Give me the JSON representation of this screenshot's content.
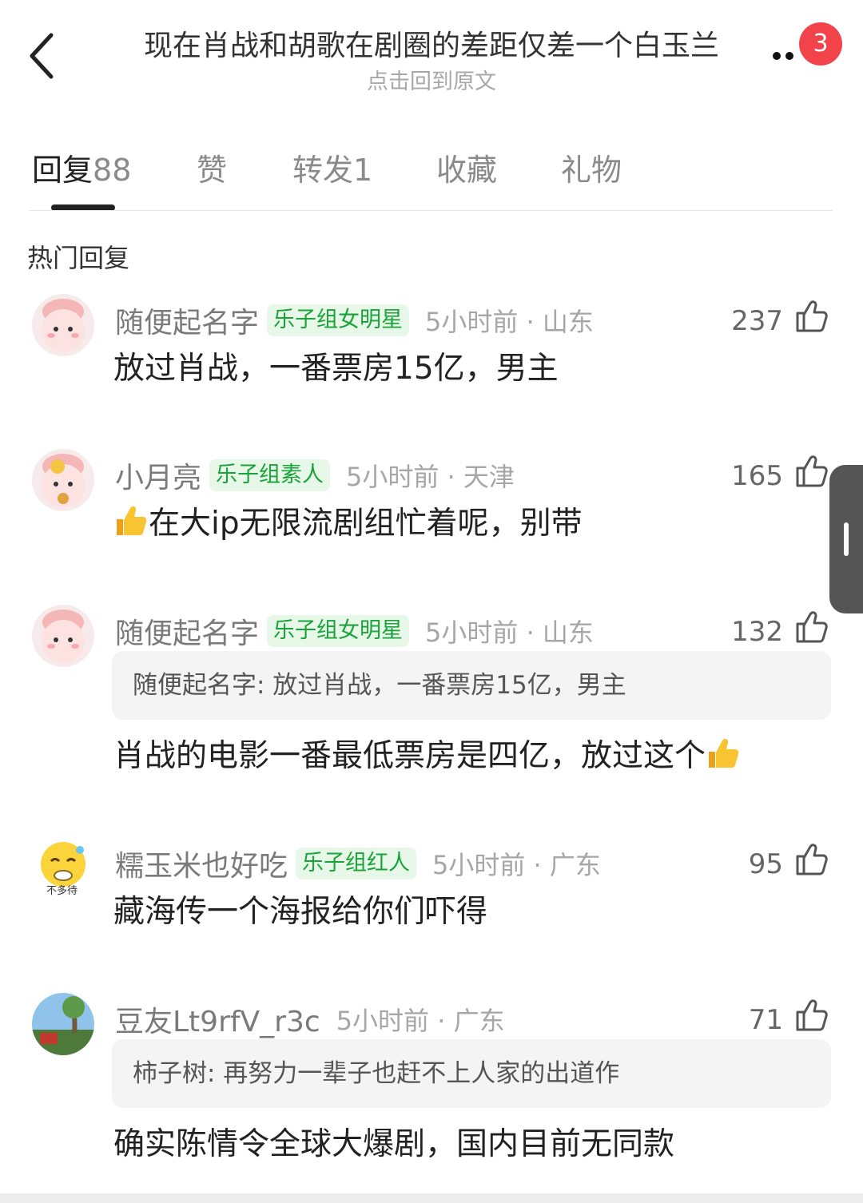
{
  "header": {
    "title": "现在肖战和胡歌在剧圈的差距仅差一个白玉兰",
    "subtitle": "点击回到原文",
    "notification_count": "3",
    "back_icon": "chevron-left-icon",
    "more_icon": "more-dots-icon"
  },
  "tabs": [
    {
      "label": "回复",
      "count": "88",
      "active": true
    },
    {
      "label": "赞",
      "count": "",
      "active": false
    },
    {
      "label": "转发",
      "count": "1",
      "active": false
    },
    {
      "label": "收藏",
      "count": "",
      "active": false
    },
    {
      "label": "礼物",
      "count": "",
      "active": false
    }
  ],
  "section_title": "热门回复",
  "comments": [
    {
      "username": "随便起名字",
      "tag": "乐子组女明星",
      "time_location": "5小时前 · 山东",
      "likes": "237",
      "text": "放过肖战，一番票房15亿，男主"
    },
    {
      "username": "小月亮",
      "tag": "乐子组素人",
      "time_location": "5小时前 · 天津",
      "likes": "165",
      "text": "在大ip无限流剧组忙着呢，别带",
      "emoji": "thumbs-up-emoji"
    },
    {
      "username": "随便起名字",
      "tag": "乐子组女明星",
      "time_location": "5小时前 · 山东",
      "likes": "132",
      "quote": "随便起名字: 放过肖战，一番票房15亿，男主",
      "text": "肖战的电影一番最低票房是四亿，放过这个",
      "emoji": "thumbs-up-emoji"
    },
    {
      "username": "糯玉米也好吃",
      "tag": "乐子组红人",
      "time_location": "5小时前 · 广东",
      "likes": "95",
      "text": "藏海传一个海报给你们吓得",
      "avatar_caption": "不多待"
    },
    {
      "username": "豆友Lt9rfV_r3c",
      "tag": "",
      "time_location": "5小时前 · 广东",
      "likes": "71",
      "quote": "柿子树: 再努力一辈子也赶不上人家的出道作",
      "text": "确实陈情令全球大爆剧，国内目前无同款"
    }
  ],
  "colors": {
    "tag_bg": "#e7f8e9",
    "tag_text": "#19a33a",
    "badge": "#f2434a"
  }
}
